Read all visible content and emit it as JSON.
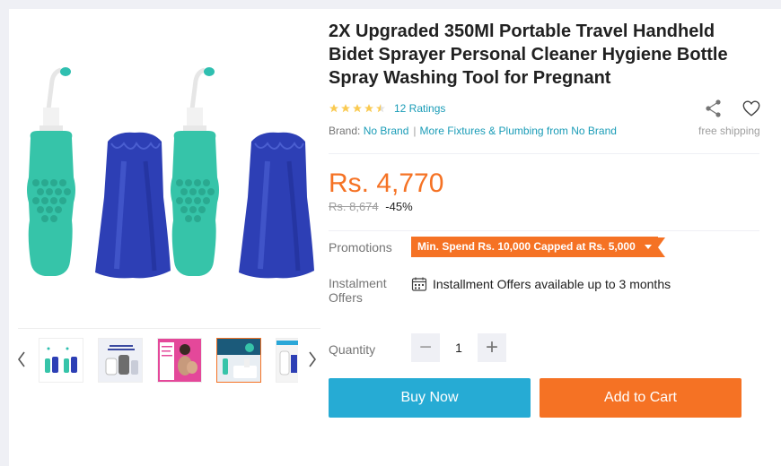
{
  "product": {
    "title": "2X Upgraded 350Ml Portable Travel Handheld Bidet Sprayer Personal Cleaner Hygiene Bottle Spray Washing Tool for Pregnant",
    "rating_stars": 4.5,
    "ratings_text": "12 Ratings",
    "brand_label": "Brand:",
    "brand_name": "No Brand",
    "more_link": "More Fixtures & Plumbing from No Brand",
    "free_shipping": "free shipping",
    "price": "Rs. 4,770",
    "original_price": "Rs. 8,674",
    "discount": "-45%"
  },
  "promotions": {
    "label": "Promotions",
    "tag": "Min. Spend Rs. 10,000 Capped at Rs. 5,000"
  },
  "instalment": {
    "label_line1": "Instalment",
    "label_line2": "Offers",
    "text": "Installment Offers available up to 3 months"
  },
  "quantity": {
    "label": "Quantity",
    "value": "1",
    "minus": "−",
    "plus": "+"
  },
  "actions": {
    "buy_now": "Buy Now",
    "add_to_cart": "Add to Cart"
  },
  "gallery": {
    "thumbnail_count": 5,
    "active_thumbnail": 4
  },
  "colors": {
    "accent_orange": "#f57224",
    "buy_blue": "#26abd4",
    "link_blue": "#1a9cb7",
    "star_gold": "#faca51"
  }
}
